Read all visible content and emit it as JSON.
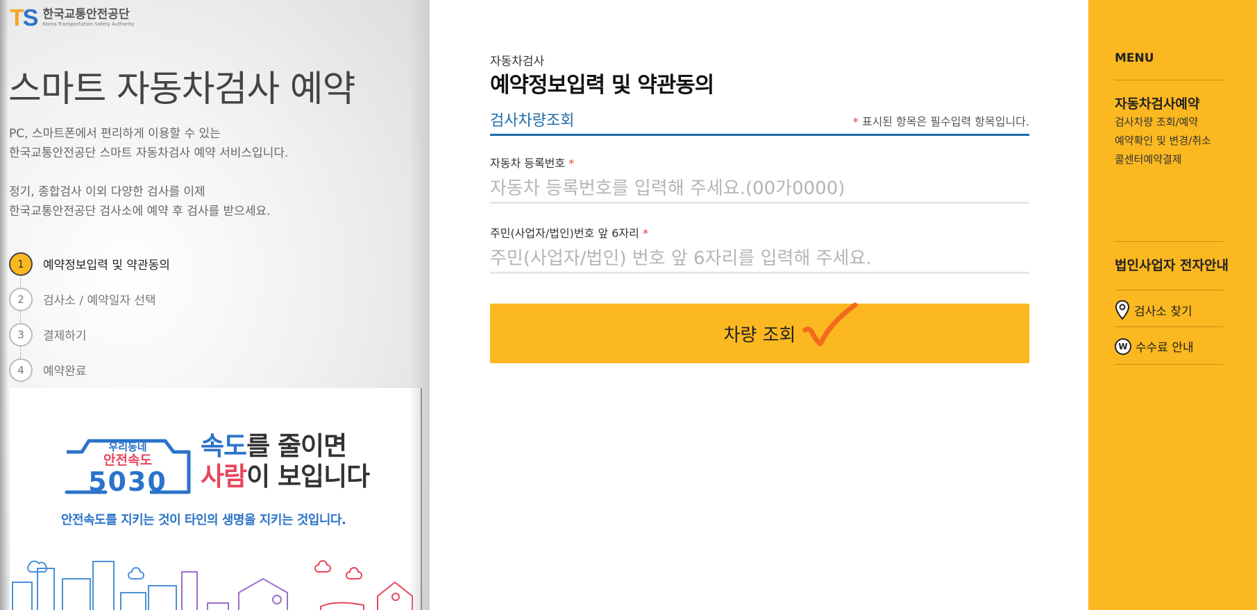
{
  "brand": {
    "logo_mark_t": "T",
    "logo_mark_s": "S",
    "org_name_ko": "한국교통안전공단",
    "org_name_en": "Korea Transportation Safety Authority"
  },
  "hero": {
    "title": "스마트 자동차검사 예약",
    "desc_line1": "PC, 스마트폰에서 편리하게 이용할 수 있는",
    "desc_line2": "한국교통안전공단 스마트 자동차검사 예약 서비스입니다.",
    "desc_line3": "정기, 종합검사 이외 다양한 검사를 이제",
    "desc_line4": "한국교통안전공단 검사소에 예약 후 검사를 받으세요."
  },
  "steps": [
    {
      "num": "1",
      "label": "예약정보입력 및 약관동의",
      "active": true
    },
    {
      "num": "2",
      "label": "검사소 / 예약일자 선택",
      "active": false
    },
    {
      "num": "3",
      "label": "결제하기",
      "active": false
    },
    {
      "num": "4",
      "label": "예약완료",
      "active": false
    }
  ],
  "banner": {
    "badge_top": "우리동네",
    "badge_mid": "안전속도",
    "badge_num": "5030",
    "head1_blue": "속도",
    "head1_rest": "를 줄이면",
    "head2_red": "사람",
    "head2_rest": "이 보입니다",
    "sub": "안전속도를 지키는 것이 타인의 생명을 지키는 것입니다."
  },
  "main": {
    "sup_title": "자동차검사",
    "title": "예약정보입력 및 약관동의",
    "section_tab": "검사차량조회",
    "required_star": "*",
    "required_note": " 표시된 항목은 필수입력 항목입니다.",
    "fields": {
      "car_label": "자동차 등록번호",
      "car_placeholder": "자동차 등록번호를 입력해 주세요.(00가0000)",
      "id_label": "주민(사업자/법인)번호 앞 6자리",
      "id_placeholder": "주민(사업자/법인) 번호 앞 6자리를 입력해 주세요."
    },
    "submit_label": "차량 조회"
  },
  "sidebar": {
    "menu_title": "MENU",
    "group_head": "자동차검사예약",
    "links": [
      "검사차량 조회/예약",
      "예약확인 및 변경/취소",
      "콜센터예약결제"
    ],
    "corp_title": "법인사업자 전자안내",
    "find_station": "검사소 찾기",
    "fee_info": "수수료 안내",
    "won_symbol": "W"
  },
  "colors": {
    "accent_yellow": "#fbb820",
    "primary_blue": "#1e6aa8",
    "required_red": "#e53935",
    "check_orange": "#f36a1d"
  }
}
